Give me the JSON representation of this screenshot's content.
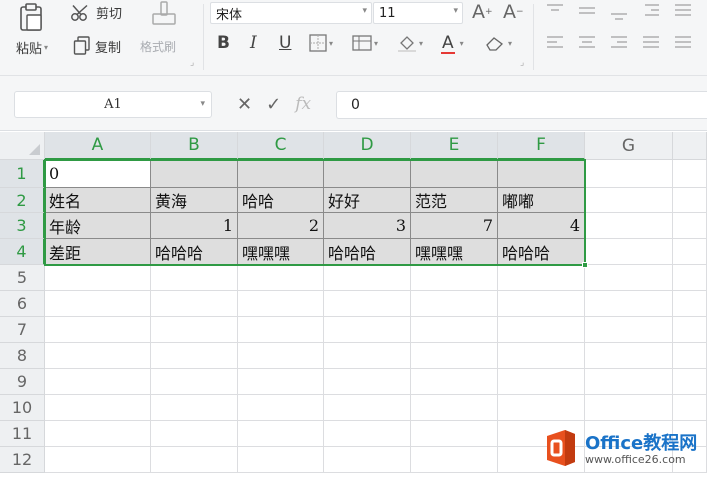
{
  "ribbon": {
    "cut_label": "剪切",
    "paste_label": "粘贴",
    "copy_label": "复制",
    "format_painter_label": "格式刷",
    "font_name": "宋体",
    "font_size": "11",
    "icons": [
      "paste-icon",
      "scissors-icon",
      "copy-icon",
      "format-painter-icon",
      "grow-font-icon",
      "shrink-font-icon",
      "bold-icon",
      "italic-icon",
      "underline-icon",
      "border-icon",
      "fill-color-icon",
      "font-color-icon",
      "clear-icon",
      "align-icon"
    ]
  },
  "formula_bar": {
    "cell_ref": "A1",
    "fx_label": "fx",
    "value": "0"
  },
  "sheet": {
    "columns": [
      "A",
      "B",
      "C",
      "D",
      "E",
      "F",
      "G"
    ],
    "rows": [
      "1",
      "2",
      "3",
      "4",
      "5",
      "6",
      "7",
      "8",
      "9",
      "10",
      "11",
      "12"
    ],
    "r1": [
      "0",
      "",
      "",
      "",
      "",
      ""
    ],
    "r2": [
      "姓名",
      "黄海",
      "哈哈",
      "好好",
      "范范",
      "嘟嘟"
    ],
    "r3": [
      "年龄",
      "1",
      "2",
      "3",
      "7",
      "4"
    ],
    "r4": [
      "差距",
      "哈哈哈",
      "嘿嘿嘿",
      "哈哈哈",
      "嘿嘿嘿",
      "哈哈哈"
    ]
  },
  "watermark": {
    "title": "Office教程网",
    "url": "www.office26.com"
  },
  "colors": {
    "selection": "#2f9a44",
    "ribbon_bg": "#f5f6f7",
    "watermark_blue": "#1a73c8",
    "watermark_orange": "#e8501e"
  }
}
